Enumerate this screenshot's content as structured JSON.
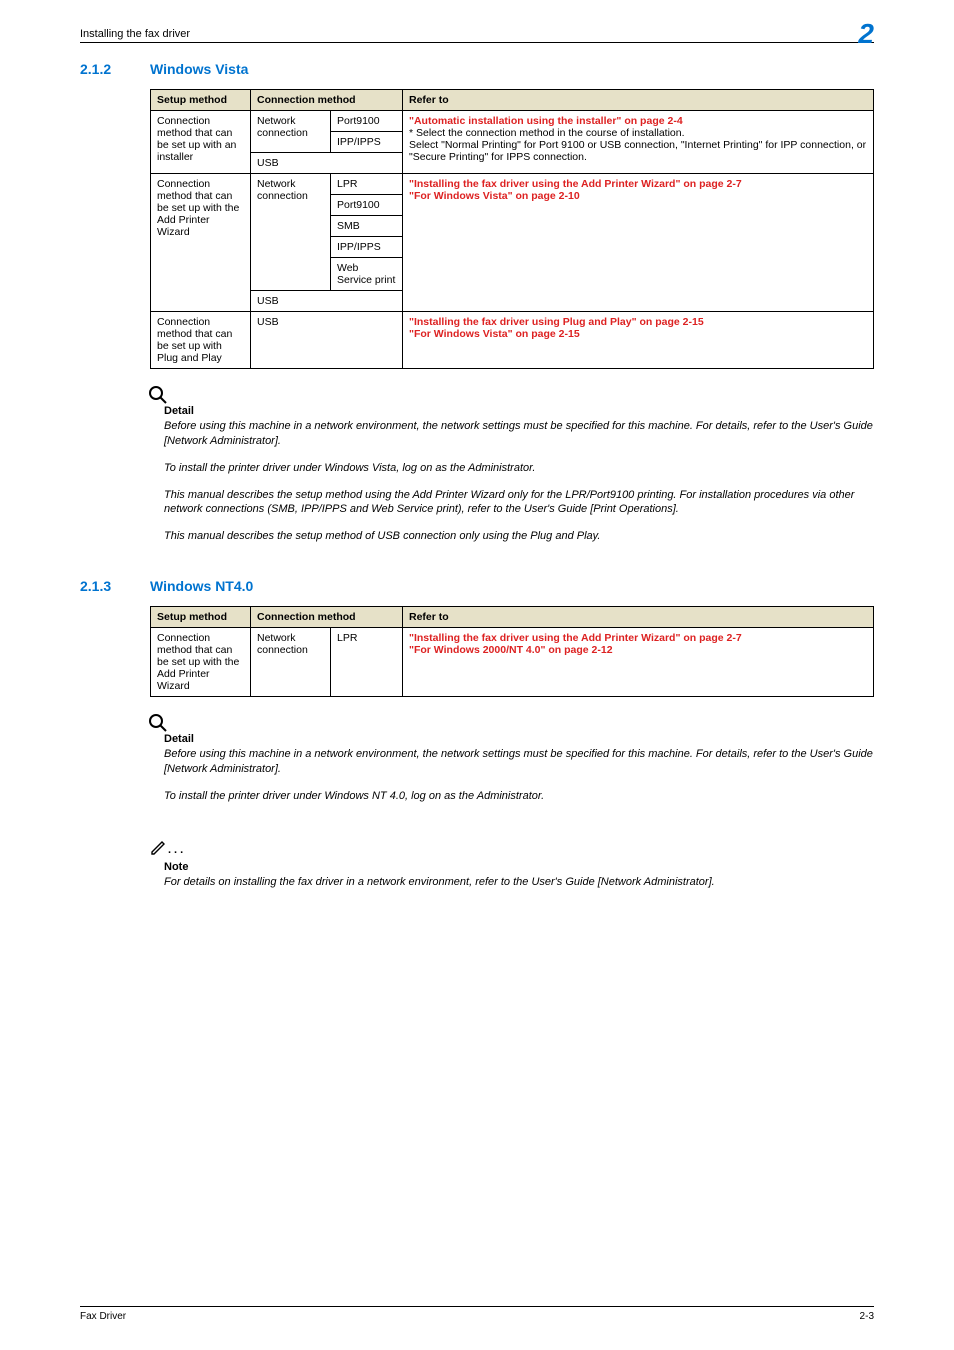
{
  "header": {
    "left": "Installing the fax driver",
    "right": "2"
  },
  "footer": {
    "left": "Fax Driver",
    "right": "2-3"
  },
  "sections": [
    {
      "num": "2.1.2",
      "title": "Windows Vista",
      "table": {
        "headers": [
          "Setup method",
          "Connection method",
          "",
          "Refer to"
        ]
      }
    },
    {
      "num": "2.1.3",
      "title": "Windows NT4.0",
      "table": {
        "headers": [
          "Setup method",
          "Connection method",
          "",
          "Refer to"
        ]
      }
    }
  ],
  "vista": {
    "setup_installer": "Connection method that can be set up with an installer",
    "setup_wizard": "Connection method that can be set up with the Add Printer Wizard",
    "setup_plugplay": "Connection method that can be set up with Plug and Play",
    "netconn": "Network connection",
    "port9100": "Port9100",
    "ippipps": "IPP/IPPS",
    "usb": "USB",
    "lpr": "LPR",
    "smb": "SMB",
    "webserv": "Web Service print",
    "refer1_l1": "\"Automatic installation using the installer\" on page 2-4",
    "refer1_l2": "* Select the connection method in the course of installation.",
    "refer1_l3": "Select \"Normal Printing\" for Port 9100 or USB connection, \"Internet Printing\" for IPP connection, or \"Secure Printing\" for IPPS connection.",
    "refer2_l1": "\"Installing the fax driver using the Add Printer Wizard\" on page 2-7",
    "refer2_l2": "\"For Windows Vista\" on page 2-10",
    "refer3_l1": "\"Installing the fax driver using Plug and Play\" on page 2-15",
    "refer3_l2": "\"For Windows Vista\" on page 2-15"
  },
  "vista_detail": {
    "heading": "Detail",
    "p1": "Before using this machine in a network environment, the network settings must be specified for this machine. For details, refer to the User's Guide [Network Administrator].",
    "p2": "To install the printer driver under Windows Vista, log on as the Administrator.",
    "p3": "This manual describes the setup method using the Add Printer Wizard only for the LPR/Port9100 printing. For installation procedures via other network connections (SMB, IPP/IPPS and Web Service print), refer to the User's Guide [Print Operations].",
    "p4": "This manual describes the setup method of USB connection only using the Plug and Play."
  },
  "nt": {
    "setup": "Connection method that can be set up with the Add Printer Wizard",
    "netconn": "Network connection",
    "lpr": "LPR",
    "refer_l1": "\"Installing the fax driver using the Add Printer Wizard\" on page 2-7",
    "refer_l2": "\"For Windows 2000/NT 4.0\" on page 2-12"
  },
  "nt_detail": {
    "heading": "Detail",
    "p1": "Before using this machine in a network environment, the network settings must be specified for this machine. For details, refer to the User's Guide [Network Administrator].",
    "p2": "To install the printer driver under Windows NT 4.0, log on as the Administrator."
  },
  "nt_note": {
    "heading": "Note",
    "p1": "For details on installing the fax driver in a network environment, refer to the User's Guide [Network Administrator]."
  }
}
